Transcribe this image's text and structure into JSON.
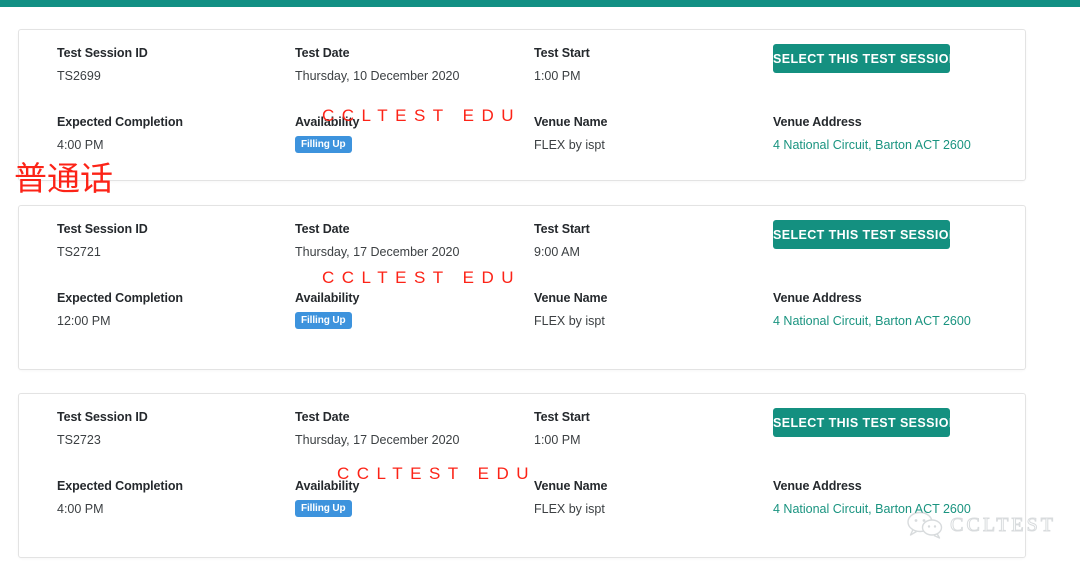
{
  "top_bar": {
    "color": "#129084"
  },
  "labels": {
    "test_session_id": "Test Session ID",
    "test_date": "Test Date",
    "test_start": "Test Start",
    "expected_completion": "Expected Completion",
    "availability": "Availability",
    "venue_name": "Venue Name",
    "venue_address": "Venue Address"
  },
  "select_button_label": "SELECT THIS TEST SESSION",
  "overlay_watermark_text": "CCLTEST EDU",
  "mandarin_annotation": "普通话",
  "corner_watermark": {
    "text": "CCLTEST",
    "icon": "chat-bubbles-icon"
  },
  "colors": {
    "accent_teal": "#149080",
    "badge_blue": "#3d93dd",
    "link_teal": "#1a9480",
    "overlay_red": "#fc2317"
  },
  "sessions": [
    {
      "session_id": "TS2699",
      "test_date": "Thursday, 10 December 2020",
      "test_start": "1:00 PM",
      "expected_completion": "4:00 PM",
      "availability": "Filling Up",
      "venue_name": "FLEX by ispt",
      "venue_address": "4 National Circuit, Barton ACT 2600"
    },
    {
      "session_id": "TS2721",
      "test_date": "Thursday, 17 December 2020",
      "test_start": "9:00 AM",
      "expected_completion": "12:00 PM",
      "availability": "Filling Up",
      "venue_name": "FLEX by ispt",
      "venue_address": "4 National Circuit, Barton ACT 2600"
    },
    {
      "session_id": "TS2723",
      "test_date": "Thursday, 17 December 2020",
      "test_start": "1:00 PM",
      "expected_completion": "4:00 PM",
      "availability": "Filling Up",
      "venue_name": "FLEX by ispt",
      "venue_address": "4 National Circuit, Barton ACT 2600"
    }
  ]
}
